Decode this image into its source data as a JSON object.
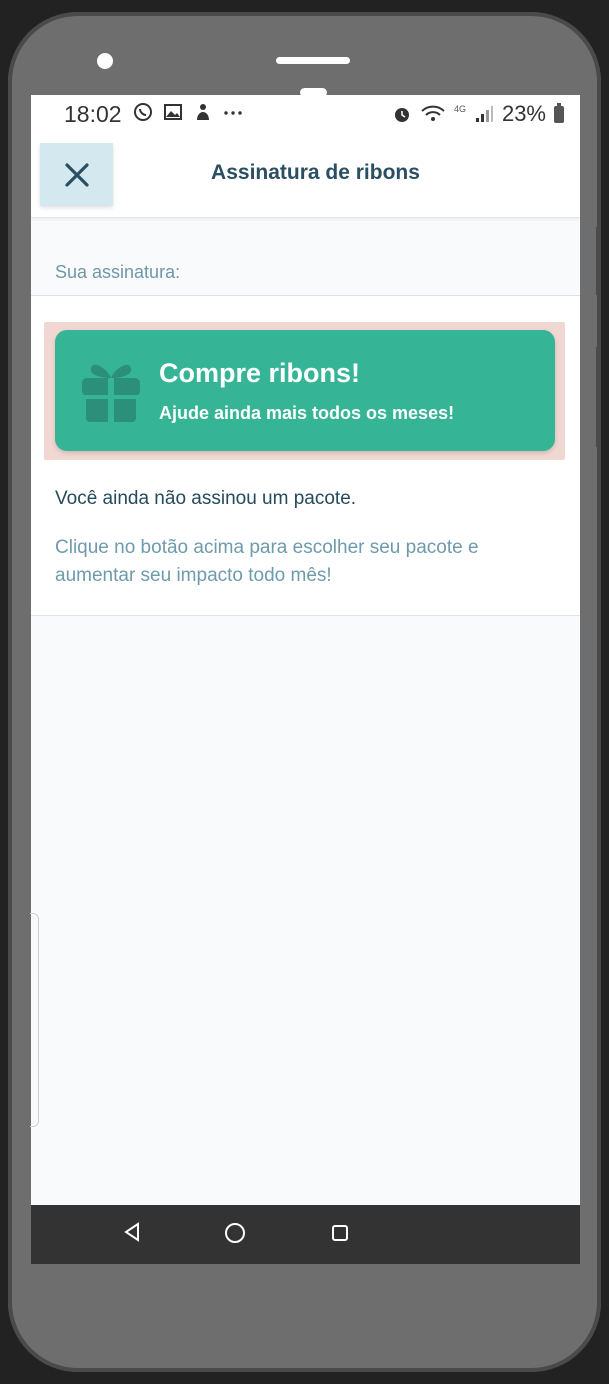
{
  "status_bar": {
    "time": "18:02",
    "battery": "23%",
    "network": "4G"
  },
  "header": {
    "title": "Assinatura de ribons",
    "close_icon": "close-icon"
  },
  "subscription": {
    "section_label": "Sua assinatura:",
    "cta_title": "Compre ribons!",
    "cta_subtitle": "Ajude ainda mais todos os meses!",
    "cta_icon": "gift-icon",
    "empty_title": "Você ainda não assinou um pacote.",
    "empty_description": "Clique no botão acima para escolher seu pacote e aumentar seu impacto todo mês!"
  },
  "navigation": {
    "back_icon": "back-triangle-icon",
    "home_icon": "home-circle-icon",
    "recents_icon": "recents-square-icon"
  },
  "colors": {
    "accent": "#36b596",
    "title": "#2a4f63",
    "muted": "#6e9bab",
    "highlight": "#f1d7d2"
  }
}
